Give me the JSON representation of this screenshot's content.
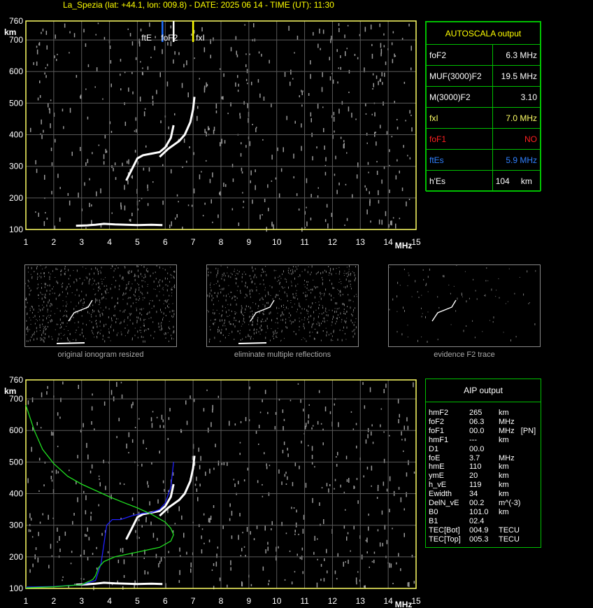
{
  "title": "La_Spezia (lat: +44.1, lon: 009.8) - DATE: 2025 06 14 - TIME (UT): 11:30",
  "colors": {
    "frame": "#ffff66",
    "grid": "#5a5a5a",
    "box": "#00c000",
    "fof2": "#ffffff",
    "fxl": "#ffff00",
    "ftes": "#1e6fff",
    "profile_blue": "#2020ff",
    "profile_green": "#20e020"
  },
  "chart_data": [
    {
      "type": "scatter",
      "name_key": "top-ionogram",
      "xlabel": "MHz",
      "ylabel": "km",
      "xlim": [
        1,
        15
      ],
      "ylim": [
        100,
        760
      ],
      "x_ticks": [
        1,
        2,
        3,
        4,
        5,
        6,
        7,
        8,
        9,
        10,
        11,
        12,
        13,
        14,
        15
      ],
      "y_ticks": [
        100,
        200,
        300,
        400,
        500,
        600,
        700,
        760
      ],
      "grid": true,
      "markers": [
        {
          "label": "ftE",
          "x": 5.9,
          "color": "#1e6fff"
        },
        {
          "label": "foF2",
          "x": 6.3,
          "color": "#ffffff"
        },
        {
          "label": "fxI",
          "x": 7.0,
          "color": "#ffff00"
        }
      ],
      "traces": [
        {
          "points": [
            [
              4.6,
              255
            ],
            [
              4.8,
              290
            ],
            [
              5.0,
              325
            ],
            [
              5.2,
              335
            ],
            [
              5.5,
              340
            ],
            [
              5.8,
              345
            ],
            [
              6.0,
              360
            ],
            [
              6.2,
              390
            ],
            [
              6.3,
              430
            ]
          ]
        },
        {
          "points": [
            [
              5.8,
              330
            ],
            [
              6.1,
              355
            ],
            [
              6.5,
              380
            ],
            [
              6.7,
              400
            ],
            [
              6.9,
              440
            ],
            [
              7.0,
              480
            ],
            [
              7.05,
              520
            ]
          ]
        },
        {
          "points": [
            [
              2.8,
              112
            ],
            [
              3.2,
              113
            ],
            [
              3.5,
              115
            ],
            [
              3.8,
              118
            ],
            [
              4.2,
              116
            ],
            [
              4.6,
              115
            ],
            [
              5.0,
              114
            ],
            [
              5.5,
              115
            ],
            [
              5.9,
              114
            ]
          ]
        }
      ]
    },
    {
      "type": "line",
      "name_key": "bottom-ionogram",
      "xlabel": "MHz",
      "ylabel": "km",
      "xlim": [
        1,
        15
      ],
      "ylim": [
        100,
        760
      ],
      "x_ticks": [
        1,
        2,
        3,
        4,
        5,
        6,
        7,
        8,
        9,
        10,
        11,
        12,
        13,
        14,
        15
      ],
      "y_ticks": [
        100,
        200,
        300,
        400,
        500,
        600,
        700,
        760
      ],
      "grid": true,
      "traces": [
        {
          "points": [
            [
              4.6,
              255
            ],
            [
              4.8,
              290
            ],
            [
              5.0,
              325
            ],
            [
              5.2,
              335
            ],
            [
              5.5,
              340
            ],
            [
              5.8,
              345
            ],
            [
              6.0,
              360
            ],
            [
              6.2,
              390
            ],
            [
              6.3,
              430
            ]
          ]
        },
        {
          "points": [
            [
              5.8,
              330
            ],
            [
              6.1,
              355
            ],
            [
              6.5,
              380
            ],
            [
              6.7,
              400
            ],
            [
              6.9,
              440
            ],
            [
              7.0,
              480
            ],
            [
              7.05,
              520
            ]
          ]
        },
        {
          "points": [
            [
              2.8,
              112
            ],
            [
              3.2,
              113
            ],
            [
              3.5,
              115
            ],
            [
              3.8,
              118
            ],
            [
              4.2,
              116
            ],
            [
              4.6,
              115
            ],
            [
              5.0,
              114
            ],
            [
              5.5,
              115
            ],
            [
              5.9,
              114
            ]
          ]
        }
      ],
      "series": [
        {
          "color": "#2020ff",
          "points": [
            [
              1.0,
              104
            ],
            [
              2.0,
              106
            ],
            [
              3.0,
              112
            ],
            [
              3.5,
              125
            ],
            [
              3.7,
              180
            ],
            [
              3.9,
              300
            ],
            [
              4.1,
              318
            ],
            [
              4.4,
              318
            ],
            [
              4.8,
              330
            ],
            [
              5.2,
              338
            ],
            [
              5.5,
              340
            ],
            [
              5.8,
              350
            ],
            [
              6.0,
              370
            ],
            [
              6.2,
              420
            ],
            [
              6.3,
              500
            ]
          ]
        },
        {
          "color": "#20e020",
          "points": [
            [
              1.0,
              680
            ],
            [
              1.3,
              600
            ],
            [
              1.6,
              540
            ],
            [
              2.0,
              495
            ],
            [
              2.5,
              455
            ],
            [
              3.0,
              430
            ],
            [
              3.5,
              410
            ],
            [
              4.0,
              390
            ],
            [
              4.5,
              372
            ],
            [
              5.0,
              355
            ],
            [
              5.5,
              335
            ],
            [
              6.0,
              310
            ],
            [
              6.2,
              290
            ],
            [
              6.3,
              270
            ],
            [
              6.2,
              250
            ],
            [
              5.8,
              230
            ],
            [
              5.0,
              215
            ],
            [
              4.2,
              200
            ],
            [
              3.8,
              185
            ],
            [
              3.6,
              165
            ],
            [
              3.5,
              140
            ],
            [
              3.4,
              128
            ],
            [
              3.0,
              112
            ],
            [
              2.0,
              105
            ],
            [
              1.0,
              102
            ]
          ]
        }
      ]
    }
  ],
  "autoscala": {
    "header": "AUTOSCALA output",
    "rows": [
      {
        "label": "foF2",
        "value": "6.3 MHz",
        "color": "#ffffff"
      },
      {
        "label": "MUF(3000)F2",
        "value": "19.5 MHz",
        "color": "#ffffff"
      },
      {
        "label": "M(3000)F2",
        "value": "3.10",
        "color": "#ffffff"
      },
      {
        "label": "fxI",
        "value": "7.0 MHz",
        "color": "#ffff66"
      },
      {
        "label": "foF1",
        "value": "NO",
        "color": "#ff2020"
      },
      {
        "label": "ftEs",
        "value": "5.9 MHz",
        "color": "#3080ff"
      },
      {
        "label": "h'Es",
        "value": "104",
        "unit": "km",
        "color": "#ffffff"
      }
    ]
  },
  "thumbs": [
    {
      "caption": "original ionogram resized"
    },
    {
      "caption": "eliminate multiple reflections"
    },
    {
      "caption": "evidence F2 trace"
    }
  ],
  "aip": {
    "header": "AIP output",
    "rows": [
      {
        "k": "hmF2",
        "v": "265",
        "u": "km"
      },
      {
        "k": "foF2",
        "v": "06.3",
        "u": "MHz"
      },
      {
        "k": "foF1",
        "v": "00.0",
        "u": "MHz   [PN]"
      },
      {
        "k": "hmF1",
        "v": "---",
        "u": "km"
      },
      {
        "k": "D1",
        "v": "00.0",
        "u": ""
      },
      {
        "k": "foE",
        "v": "3.7",
        "u": "MHz"
      },
      {
        "k": "hmE",
        "v": "110",
        "u": "km"
      },
      {
        "k": "ymE",
        "v": "20",
        "u": "km"
      },
      {
        "k": "h_vE",
        "v": "119",
        "u": "km"
      },
      {
        "k": "Ewidth",
        "v": "34",
        "u": "km"
      },
      {
        "k": "DelN_vE",
        "v": "00.2",
        "u": "m^(-3)"
      },
      {
        "k": "B0",
        "v": "101.0",
        "u": "km"
      },
      {
        "k": "B1",
        "v": "02.4",
        "u": ""
      },
      {
        "k": "TEC[Bot]",
        "v": "004.9",
        "u": "TECU"
      },
      {
        "k": "TEC[Top]",
        "v": "005.3",
        "u": "TECU"
      }
    ]
  }
}
